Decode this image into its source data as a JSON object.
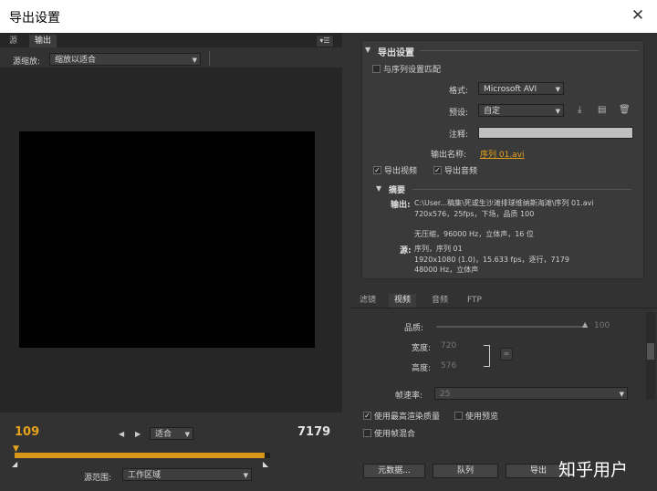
{
  "window": {
    "title": "导出设置",
    "close": "✕"
  },
  "left": {
    "tabs": [
      "源",
      "输出"
    ],
    "menu_glyph": "▾☰",
    "source_scaling": {
      "label": "源缩放:",
      "value": "缩放以适合"
    },
    "timecode_in": "109",
    "timecode_out": "7179",
    "fit": "适合",
    "source_range": {
      "label": "源范围:",
      "value": "工作区域"
    }
  },
  "export": {
    "section_title": "导出设置",
    "match_sequence": "与序列设置匹配",
    "format": {
      "label": "格式:",
      "value": "Microsoft AVI"
    },
    "preset": {
      "label": "预设:",
      "value": "自定"
    },
    "comment": {
      "label": "注释:",
      "value": ""
    },
    "output_name": {
      "label": "输出名称:",
      "value": "序列 01.avi"
    },
    "export_video": "导出视频",
    "export_audio": "导出音频"
  },
  "summary": {
    "title": "摘要",
    "output_label": "输出:",
    "output_lines": [
      "C:\\User...稿集\\死或生沙滩排球维纳斯海滩\\序列 01.avi",
      "720x576，25fps，下场，品质 100",
      "无压缩，96000 Hz，立体声，16 位"
    ],
    "source_label": "源:",
    "source_lines": [
      "序列，序列 01",
      "1920x1080 (1.0)，15.633 fps，逐行，7179",
      "48000 Hz，立体声"
    ]
  },
  "bottom_tabs": [
    "滤镜",
    "视频",
    "音频",
    "FTP"
  ],
  "video": {
    "quality": {
      "label": "品质:",
      "value": "100",
      "level": 1.0
    },
    "width": {
      "label": "宽度:",
      "value": "720"
    },
    "height": {
      "label": "高度:",
      "value": "576"
    },
    "frame_rate": {
      "label": "帧速率:",
      "value": "25"
    }
  },
  "options": {
    "max_render": "使用最高渲染质量",
    "use_preview": "使用预览",
    "frame_blend": "使用帧混合"
  },
  "buttons": {
    "metadata": "元数据...",
    "queue": "队列",
    "export": "导出"
  },
  "watermark": "知乎用户"
}
